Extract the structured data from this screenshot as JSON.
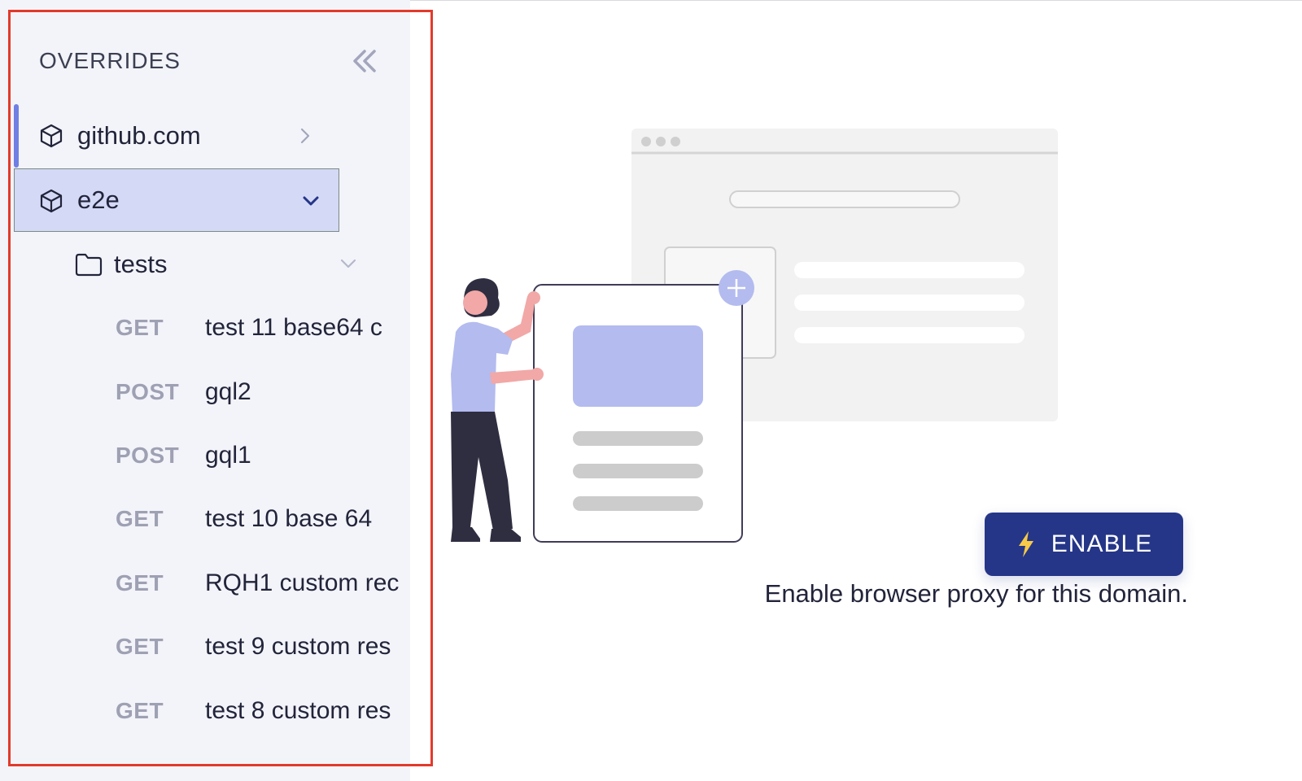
{
  "sidebar": {
    "title": "OVERRIDES",
    "domains": [
      {
        "label": "github.com",
        "expanded": false,
        "active": true
      },
      {
        "label": "e2e",
        "expanded": true,
        "selected": true
      }
    ],
    "folder": {
      "label": "tests"
    },
    "requests": [
      {
        "method": "GET",
        "name": "test 11 base64 c"
      },
      {
        "method": "POST",
        "name": "gql2"
      },
      {
        "method": "POST",
        "name": "gql1"
      },
      {
        "method": "GET",
        "name": "test 10 base 64"
      },
      {
        "method": "GET",
        "name": "RQH1 custom rec"
      },
      {
        "method": "GET",
        "name": "test 9 custom res"
      },
      {
        "method": "GET",
        "name": "test 8 custom res"
      }
    ]
  },
  "main": {
    "enable_button": "ENABLE",
    "caption": "Enable browser proxy for this domain."
  },
  "colors": {
    "accent": "#253688",
    "selected_row": "#d4d9f6",
    "highlight_border": "#e23a2b",
    "active_bar": "#6f7fe3"
  },
  "icons": [
    "chevrons-left-icon",
    "cube-icon",
    "chevron-right-icon",
    "chevron-down-icon",
    "folder-icon",
    "bolt-icon"
  ]
}
